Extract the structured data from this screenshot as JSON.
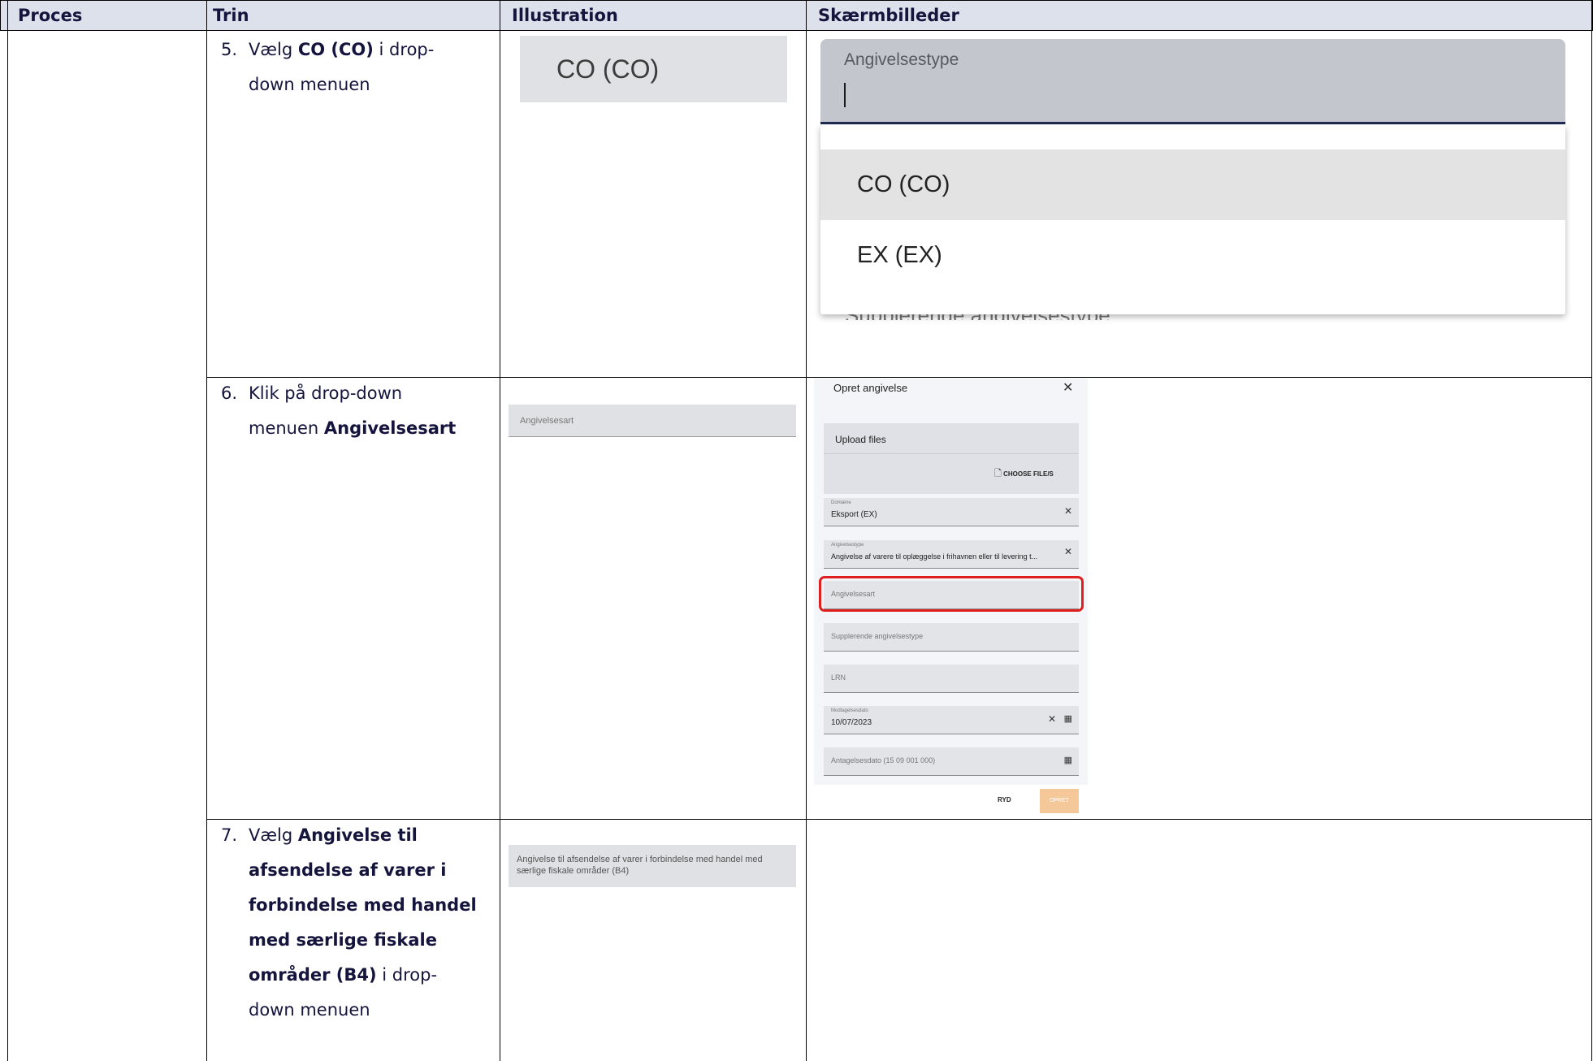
{
  "table": {
    "headers": [
      "Proces",
      "Trin",
      "Illustration",
      "Skærmbilleder"
    ]
  },
  "step5": {
    "number": "5.",
    "line1_pre": "Vælg ",
    "line1_bold": "CO (CO)",
    "line1_post": " i drop-",
    "line2": "down menuen",
    "illustration_text": "CO (CO)",
    "screenshot": {
      "field_label": "Angivelsestype",
      "options": [
        "CO (CO)",
        "EX (EX)"
      ],
      "cut_off_text": "Supplerende angivelsestype"
    }
  },
  "step6": {
    "number": "6.",
    "line1": "Klik på drop-down",
    "line2_pre": "menuen ",
    "line2_bold": "Angivelsesart",
    "illustration_text": "Angivelsesart",
    "dialog": {
      "title": "Opret angivelse",
      "upload_label": "Upload files",
      "choose_files": "CHOOSE FILE/S",
      "domain_label": "Domæne",
      "domain_value": "Eksport (EX)",
      "type_label": "Angivelsestype",
      "type_value": "Angivelse af varere til oplæggelse i frihavnen eller til levering t...",
      "art_placeholder": "Angivelsesart",
      "suppl_placeholder": "Supplerende angivelsestype",
      "lrn_placeholder": "LRN",
      "received_label": "Modtagelsesdato",
      "received_value": "10/07/2023",
      "accepted_placeholder": "Antagelsesdato (15 09 001 000)",
      "clear_button": "RYD",
      "create_button": "OPRET"
    }
  },
  "step7": {
    "number": "7.",
    "lines_bold": [
      "Angivelse til",
      "afsendelse af varer i",
      "forbindelse med handel",
      "med særlige fiskale"
    ],
    "line5_bold": "områder (B4)",
    "line5_post": " i drop-",
    "line6": "down menuen",
    "line1_pre": "Vælg ",
    "illustration_text": "Angivelse til afsendelse af varer i forbindelse med handel med særlige fiskale områder (B4)"
  },
  "colors": {
    "header_bg": "#dde1eb",
    "highlight_red": "#e02020",
    "disabled_button": "#f5c89a"
  }
}
